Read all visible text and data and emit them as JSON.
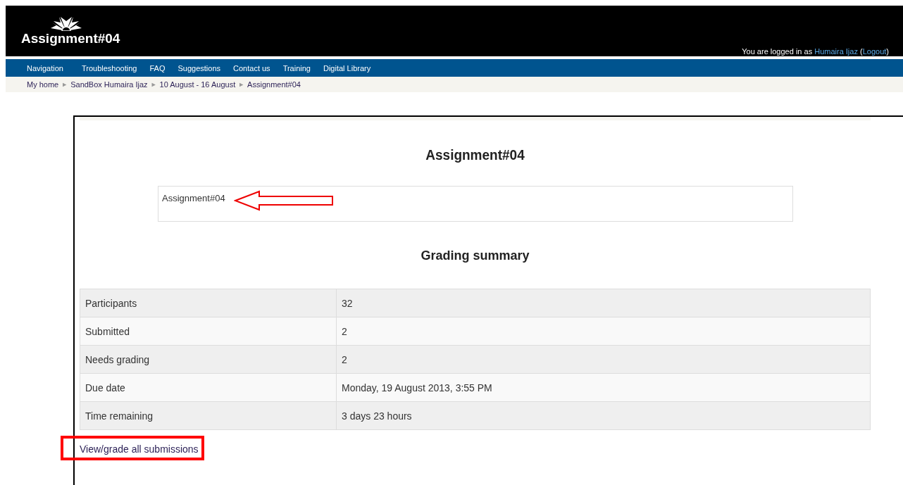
{
  "header": {
    "title": "Assignment#04",
    "login": {
      "prefix": "You are logged in as",
      "user": "Humaira Ijaz",
      "open": "(",
      "logout": "Logout",
      "close": ")"
    }
  },
  "nav": [
    "Navigation",
    "Troubleshooting",
    "FAQ",
    "Suggestions",
    "Contact us",
    "Training",
    "Digital Library"
  ],
  "breadcrumb": {
    "separator": "►",
    "items": [
      "My home",
      "SandBox Humaira Ijaz",
      "10 August - 16 August",
      "Assignment#04"
    ]
  },
  "main": {
    "heading": "Assignment#04",
    "intro": "Assignment#04",
    "summary_heading": "Grading summary",
    "rows": [
      {
        "label": "Participants",
        "value": "32"
      },
      {
        "label": "Submitted",
        "value": "2"
      },
      {
        "label": "Needs grading",
        "value": "2"
      },
      {
        "label": "Due date",
        "value": "Monday, 19 August 2013, 3:55 PM"
      },
      {
        "label": "Time remaining",
        "value": "3 days 23 hours"
      }
    ],
    "link": "View/grade all submissions"
  }
}
